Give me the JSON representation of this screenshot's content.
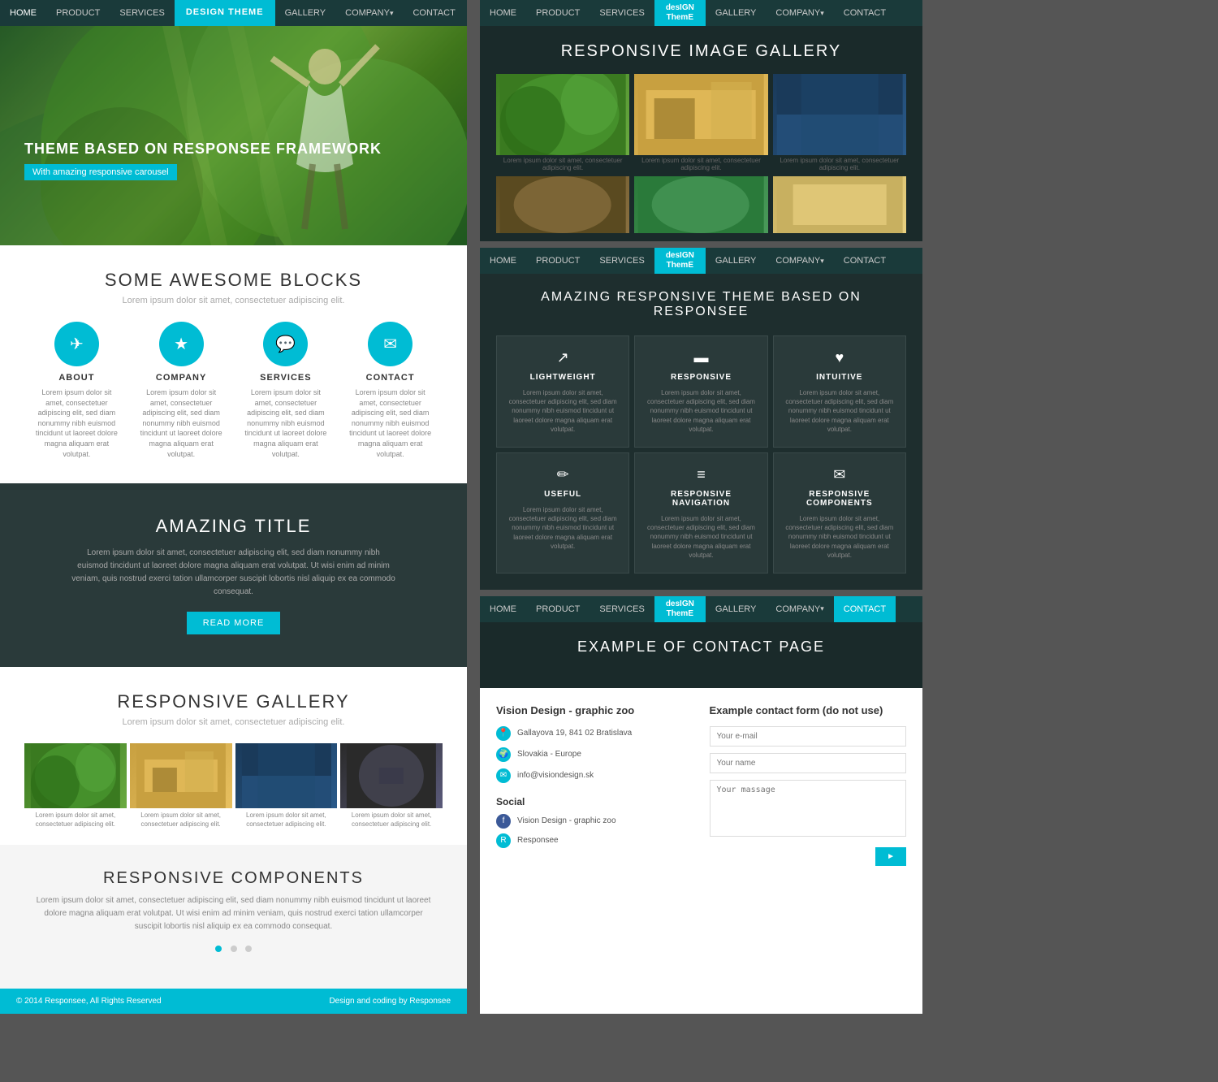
{
  "left": {
    "nav": {
      "items": [
        "HOME",
        "PRODUCT",
        "SERVICES",
        "DESIGN THEME",
        "GALLERY",
        "COMPANY",
        "CONTACT"
      ],
      "active": "DESIGN THEME"
    },
    "hero": {
      "title": "THEME BASED ON RESPONSEE FRAMEWORK",
      "badge": "With amazing responsive carousel"
    },
    "blocks": {
      "heading": "SOME AWESOME BLOCKS",
      "subtitle": "Lorem ipsum dolor sit amet, consectetuer adipiscing elit.",
      "items": [
        {
          "icon": "✈",
          "title": "ABOUT",
          "desc": "Lorem ipsum dolor sit amet, consectetuer adipiscing elit, sed diam nonummy nibh euismod tincidunt ut laoreet dolore magna aliquam erat volutpat."
        },
        {
          "icon": "★",
          "title": "COMPANY",
          "desc": "Lorem ipsum dolor sit amet, consectetuer adipiscing elit, sed diam nonummy nibh euismod tincidunt ut laoreet dolore magna aliquam erat volutpat."
        },
        {
          "icon": "💬",
          "title": "SERVICES",
          "desc": "Lorem ipsum dolor sit amet, consectetuer adipiscing elit, sed diam nonummy nibh euismod tincidunt ut laoreet dolore magna aliquam erat volutpat."
        },
        {
          "icon": "✉",
          "title": "CONTACT",
          "desc": "Lorem ipsum dolor sit amet, consectetuer adipiscing elit, sed diam nonummy nibh euismod tincidunt ut laoreet dolore magna aliquam erat volutpat."
        }
      ]
    },
    "dark_section": {
      "heading": "AMAZING TITLE",
      "text": "Lorem ipsum dolor sit amet, consectetuer adipiscing elit, sed diam nonummy nibh euismod tincidunt ut laoreet dolore magna aliquam erat volutpat. Ut wisi enim ad minim veniam, quis nostrud exerci tation ullamcorper suscipit lobortis nisl aliquip ex ea commodo consequat.",
      "button": "READ MORE"
    },
    "gallery": {
      "heading": "RESPONSIVE GALLERY",
      "subtitle": "Lorem ipsum dolor sit amet, consectetuer adipiscing elit.",
      "captions": [
        "Lorem ipsum dolor sit amet, consectetuer adipiscing elit.",
        "Lorem ipsum dolor sit amet, consectetuer adipiscing elit.",
        "Lorem ipsum dolor sit amet, consectetuer adipiscing elit.",
        "Lorem ipsum dolor sit amet, consectetuer adipiscing elit."
      ]
    },
    "components": {
      "heading": "RESPONSIVE COMPONENTS",
      "text": "Lorem ipsum dolor sit amet, consectetuer adipiscing elit, sed diam nonummy nibh euismod tincidunt ut laoreet dolore magna aliquam erat volutpat. Ut wisi enim ad minim veniam, quis nostrud exerci tation ullamcorper suscipit lobortis nisl aliquip ex ea commodo consequat."
    },
    "footer": {
      "left": "© 2014 Responsee, All Rights Reserved",
      "right": "Design and coding by Responsee"
    }
  },
  "right": {
    "panels": [
      {
        "type": "gallery",
        "nav_active": "DESIGN THEME",
        "heading": "RESPONSIVE IMAGE GALLERY",
        "captions": [
          "Lorem ipsum dolor sit amet, consectetuer adipiscing elit.",
          "Lorem ipsum dolor sit amet, consectetuer adipiscing elit.",
          "Lorem ipsum dolor sit amet, consectetuer adipiscing elit."
        ]
      },
      {
        "type": "features",
        "nav_active": "DESIGN THEME",
        "heading": "AMAZING RESPONSIVE THEME BASED ON RESPONSEE",
        "features": [
          {
            "icon": "↗",
            "title": "LIGHTWEIGHT",
            "desc": "Lorem ipsum dolor sit amet, consectetuer adipiscing elit, sed diam nonummy nibh euismod tincidunt ut laoreet dolore magna aliquam erat volutpat."
          },
          {
            "icon": "▬",
            "title": "RESPONSIVE",
            "desc": "Lorem ipsum dolor sit amet, consectetuer adipiscing elit, sed diam nonummy nibh euismod tincidunt ut laoreet dolore magna aliquam erat volutpat."
          },
          {
            "icon": "♥",
            "title": "INTUITIVE",
            "desc": "Lorem ipsum dolor sit amet, consectetuer adipiscing elit, sed diam nonummy nibh euismod tincidunt ut laoreet dolore magna aliquam erat volutpat."
          },
          {
            "icon": "✏",
            "title": "USEFUL",
            "desc": "Lorem ipsum dolor sit amet, consectetuer adipiscing elit, sed diam nonummy nibh euismod tincidunt ut laoreet dolore magna aliquam erat volutpat."
          },
          {
            "icon": "≡",
            "title": "RESPONSIVE NAVIGATION",
            "desc": "Lorem ipsum dolor sit amet, consectetuer adipiscing elit, sed diam nonummy nibh euismod tincidunt ut laoreet dolore magna aliquam erat volutpat."
          },
          {
            "icon": "✉",
            "title": "RESPONSIVE COMPONENTS",
            "desc": "Lorem ipsum dolor sit amet, consectetuer adipiscing elit, sed diam nonummy nibh euismod tincidunt ut laoreet dolore magna aliquam erat volutpat."
          }
        ]
      },
      {
        "type": "contact",
        "nav_active": "CONTACT",
        "heading": "EXAMPLE OF CONTACT PAGE",
        "company": "Vision Design - graphic zoo",
        "address": "Gallayova 19, 841 02 Bratislava",
        "country": "Slovakia - Europe",
        "email": "info@visiondesign.sk",
        "social_heading": "Social",
        "social_items": [
          "Vision Design - graphic zoo",
          "Responsee"
        ],
        "form_heading": "Example contact form (do not use)",
        "placeholders": {
          "email": "Your e-mail",
          "name": "Your name",
          "message": "Your massage"
        },
        "submit": "►"
      }
    ]
  }
}
